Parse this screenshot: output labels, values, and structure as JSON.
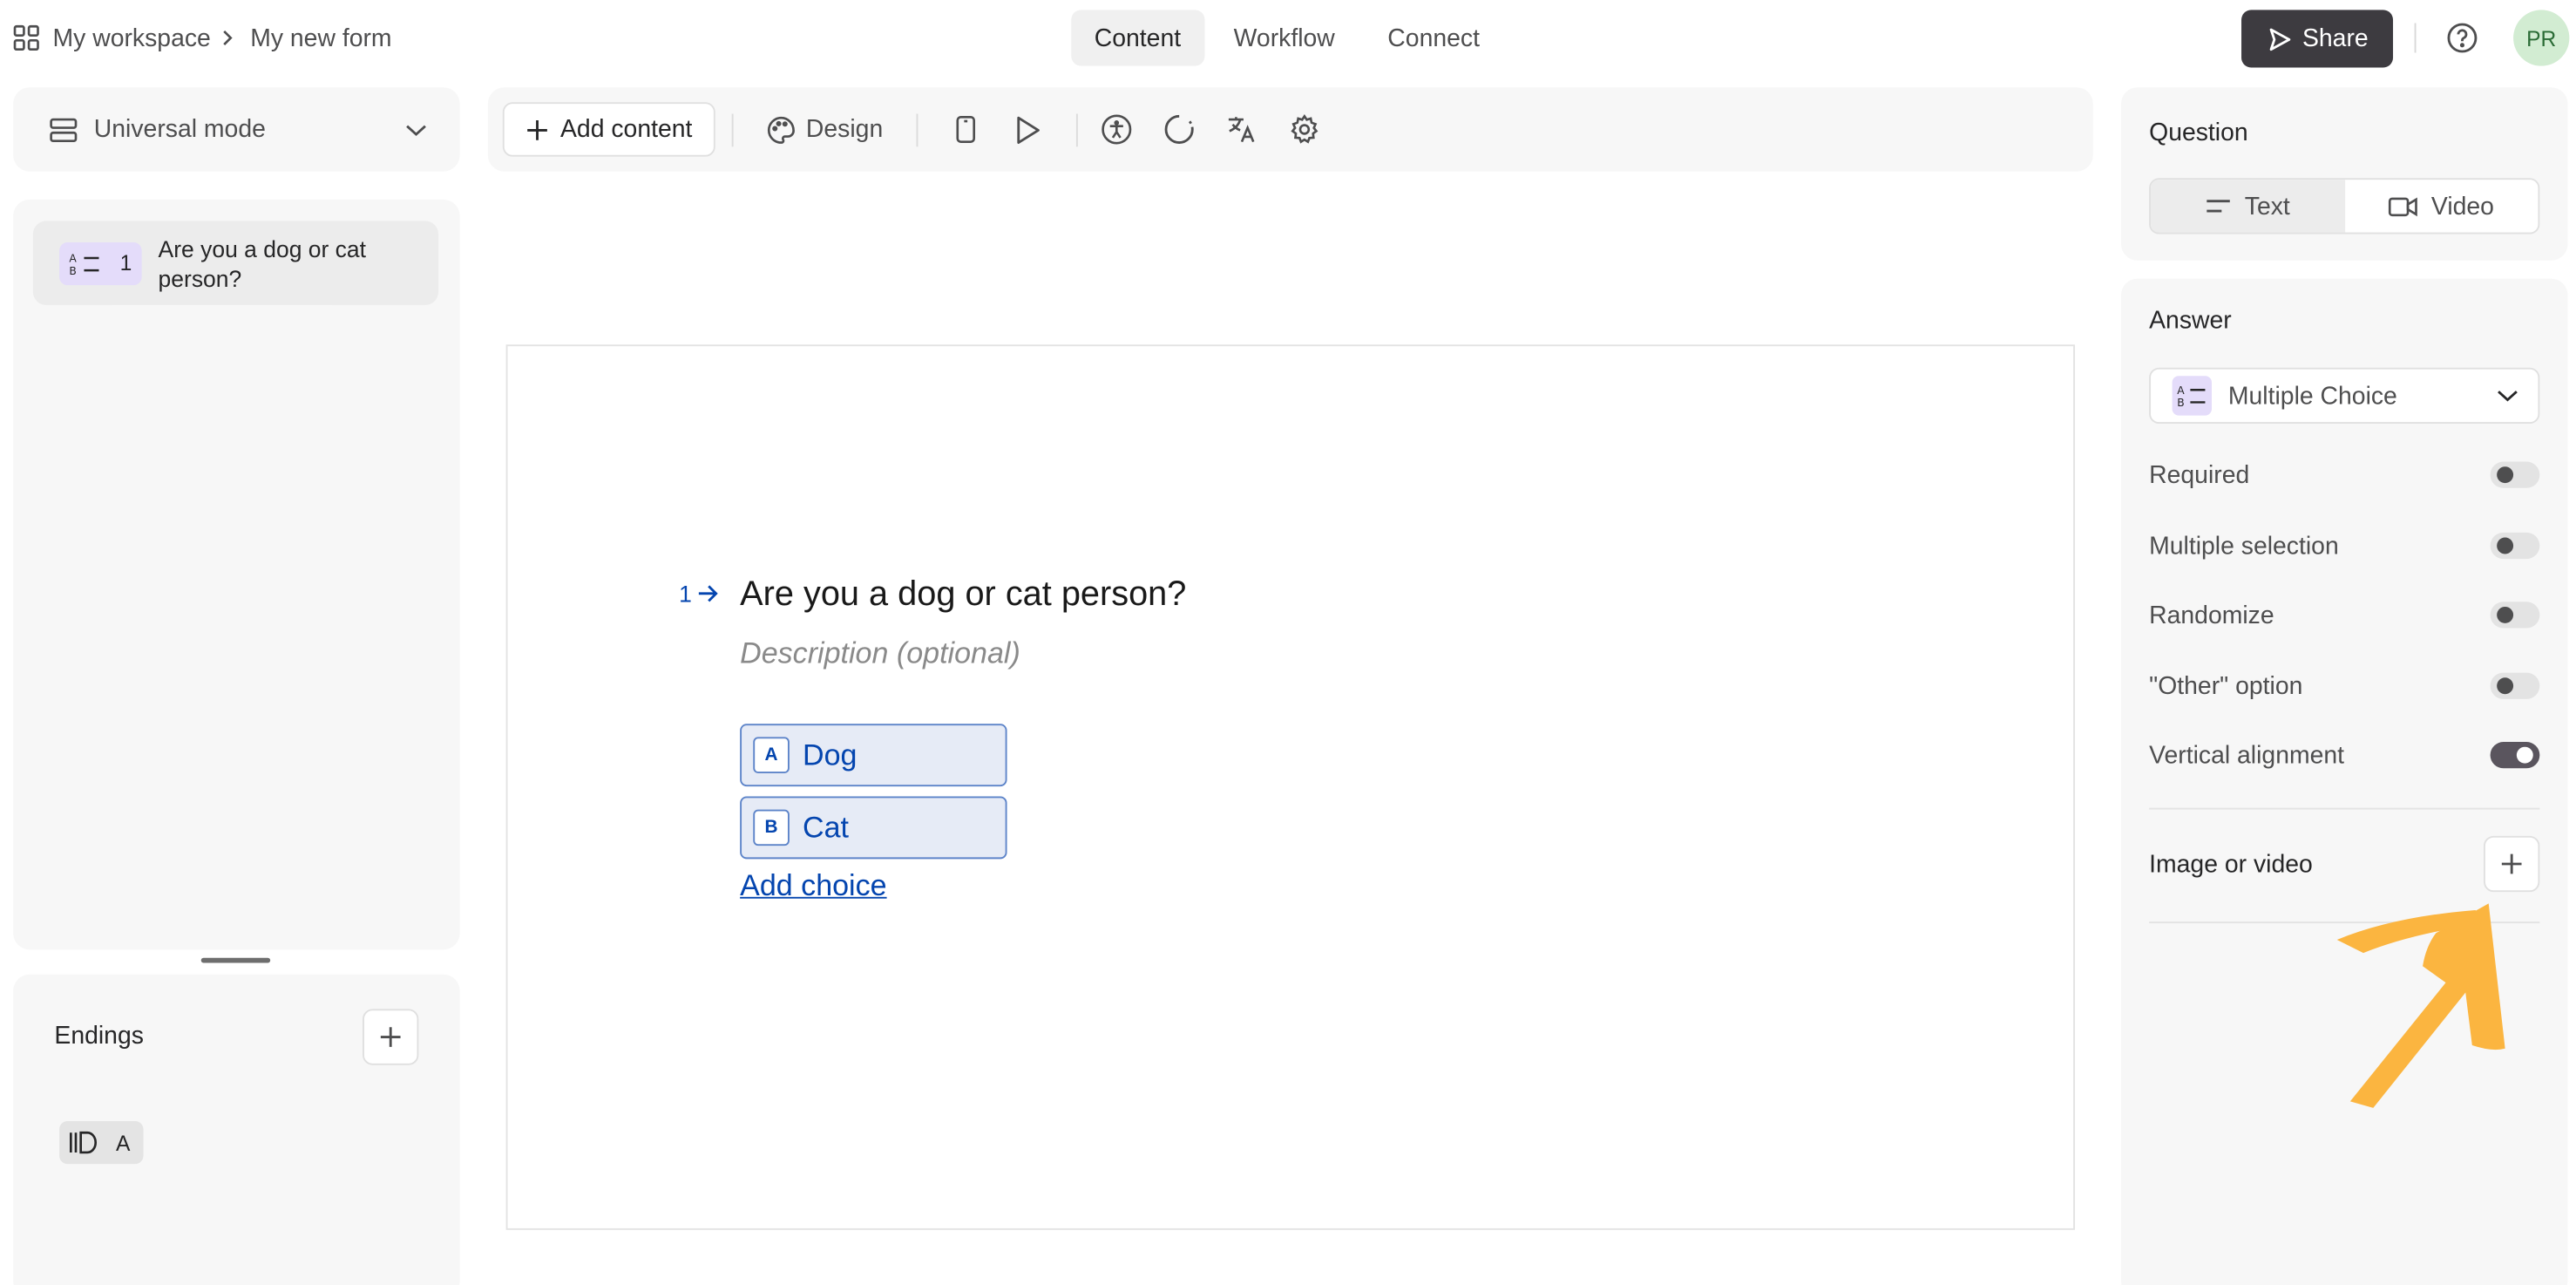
{
  "header": {
    "workspace": "My workspace",
    "form_name": "My new form",
    "tabs": [
      {
        "label": "Content",
        "active": true
      },
      {
        "label": "Workflow",
        "active": false
      },
      {
        "label": "Connect",
        "active": false
      }
    ],
    "share_label": "Share",
    "avatar_initials": "PR"
  },
  "sidebar": {
    "mode_label": "Universal mode",
    "questions": [
      {
        "number": "1",
        "text": "Are you a dog or cat person?",
        "icon": "multiple-choice-icon"
      }
    ],
    "endings_title": "Endings",
    "endings": [
      {
        "key": "A",
        "icon": "ending-icon"
      }
    ]
  },
  "toolbar": {
    "add_content_label": "Add content",
    "design_label": "Design",
    "icons": [
      "mobile-preview-icon",
      "play-preview-icon",
      "accessibility-icon",
      "loading-icon",
      "translate-icon",
      "settings-icon"
    ]
  },
  "canvas": {
    "question_number": "1",
    "question_title": "Are you a dog or cat person?",
    "description_placeholder": "Description (optional)",
    "choices": [
      {
        "key": "A",
        "label": "Dog"
      },
      {
        "key": "B",
        "label": "Cat"
      }
    ],
    "add_choice_label": "Add choice"
  },
  "settings": {
    "question_title": "Question",
    "question_types": [
      {
        "label": "Text",
        "active": true
      },
      {
        "label": "Video",
        "active": false
      }
    ],
    "answer_title": "Answer",
    "answer_type": "Multiple Choice",
    "toggles": [
      {
        "label": "Required",
        "on": false
      },
      {
        "label": "Multiple selection",
        "on": false
      },
      {
        "label": "Randomize",
        "on": false
      },
      {
        "label": "\"Other\" option",
        "on": false
      },
      {
        "label": "Vertical alignment",
        "on": true
      }
    ],
    "media_label": "Image or video"
  },
  "colors": {
    "accent_blue": "#0445af",
    "choice_bg": "#e6ebf6",
    "badge_purple": "#e4dcfa",
    "share_bg": "#3d3b40",
    "annotation_arrow": "#fbb540"
  }
}
